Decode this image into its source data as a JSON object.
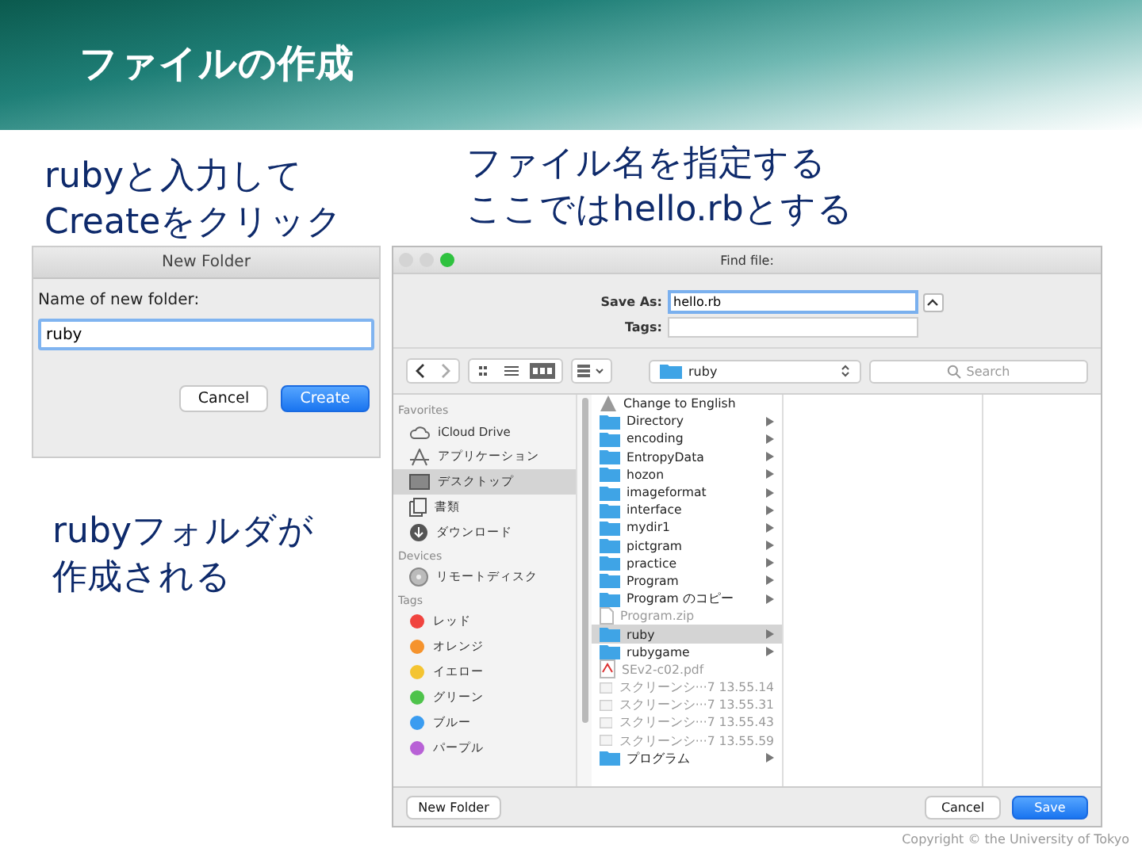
{
  "slide_title": "ファイルの作成",
  "captions": [
    {
      "lines": [
        "rubyと入力して",
        "Createをクリック"
      ]
    },
    {
      "lines": [
        "ファイル名を指定する",
        "ここではhello.rbとする"
      ]
    },
    {
      "lines": [
        "rubyフォルダが",
        "作成される"
      ]
    }
  ],
  "new_folder_dialog": {
    "title": "New Folder",
    "label": "Name of new folder:",
    "value": "ruby",
    "buttons": [
      {
        "label": "Cancel",
        "default": false
      },
      {
        "label": "Create",
        "default": true
      }
    ]
  },
  "save_dialog": {
    "title": "Find file:",
    "save_as_label": "Save As:",
    "save_as_value": "hello.rb",
    "tags_label": "Tags:",
    "location": "ruby",
    "search_placeholder": "Search",
    "sidebar": [
      {
        "heading": "Favorites",
        "items": [
          {
            "label": "iCloud Drive",
            "kind": "cloud",
            "selected": false
          },
          {
            "label": "アプリケーション",
            "kind": "apps",
            "selected": false
          },
          {
            "label": "デスクトップ",
            "kind": "desktop",
            "selected": true
          },
          {
            "label": "書類",
            "kind": "documents",
            "selected": false
          },
          {
            "label": "ダウンロード",
            "kind": "download",
            "selected": false
          }
        ]
      },
      {
        "heading": "Devices",
        "items": [
          {
            "label": "リモートディスク",
            "kind": "disc",
            "selected": false
          }
        ]
      },
      {
        "heading": "Tags",
        "items": [
          {
            "label": "レッド",
            "kind": "tag",
            "color": "#f0443f",
            "selected": false
          },
          {
            "label": "オレンジ",
            "kind": "tag",
            "color": "#f5932d",
            "selected": false
          },
          {
            "label": "イエロー",
            "kind": "tag",
            "color": "#f4c431",
            "selected": false
          },
          {
            "label": "グリーン",
            "kind": "tag",
            "color": "#4ec34b",
            "selected": false
          },
          {
            "label": "ブルー",
            "kind": "tag",
            "color": "#3a9cf0",
            "selected": false
          },
          {
            "label": "パープル",
            "kind": "tag",
            "color": "#b861d6",
            "selected": false
          }
        ]
      }
    ],
    "files": [
      {
        "name": "Change to English",
        "kind": "app",
        "disabled": false,
        "selected": false,
        "has_children": false
      },
      {
        "name": "Directory",
        "kind": "folder",
        "disabled": false,
        "selected": false,
        "has_children": true
      },
      {
        "name": "encoding",
        "kind": "folder",
        "disabled": false,
        "selected": false,
        "has_children": true
      },
      {
        "name": "EntropyData",
        "kind": "folder",
        "disabled": false,
        "selected": false,
        "has_children": true
      },
      {
        "name": "hozon",
        "kind": "folder",
        "disabled": false,
        "selected": false,
        "has_children": true
      },
      {
        "name": "imageformat",
        "kind": "folder",
        "disabled": false,
        "selected": false,
        "has_children": true
      },
      {
        "name": "interface",
        "kind": "folder",
        "disabled": false,
        "selected": false,
        "has_children": true
      },
      {
        "name": "mydir1",
        "kind": "folder",
        "disabled": false,
        "selected": false,
        "has_children": true
      },
      {
        "name": "pictgram",
        "kind": "folder",
        "disabled": false,
        "selected": false,
        "has_children": true
      },
      {
        "name": "practice",
        "kind": "folder",
        "disabled": false,
        "selected": false,
        "has_children": true
      },
      {
        "name": "Program",
        "kind": "folder",
        "disabled": false,
        "selected": false,
        "has_children": true
      },
      {
        "name": "Program のコピー",
        "kind": "folder",
        "disabled": false,
        "selected": false,
        "has_children": true
      },
      {
        "name": "Program.zip",
        "kind": "file",
        "disabled": true,
        "selected": false,
        "has_children": false
      },
      {
        "name": "ruby",
        "kind": "folder",
        "disabled": false,
        "selected": true,
        "has_children": true
      },
      {
        "name": "rubygame",
        "kind": "folder",
        "disabled": false,
        "selected": false,
        "has_children": true
      },
      {
        "name": "SEv2-c02.pdf",
        "kind": "pdf",
        "disabled": true,
        "selected": false,
        "has_children": false
      },
      {
        "name": "スクリーンシ···7 13.55.14",
        "kind": "image",
        "disabled": true,
        "selected": false,
        "has_children": false
      },
      {
        "name": "スクリーンシ···7 13.55.31",
        "kind": "image",
        "disabled": true,
        "selected": false,
        "has_children": false
      },
      {
        "name": "スクリーンシ···7 13.55.43",
        "kind": "image",
        "disabled": true,
        "selected": false,
        "has_children": false
      },
      {
        "name": "スクリーンシ···7 13.55.59",
        "kind": "image",
        "disabled": true,
        "selected": false,
        "has_children": false
      },
      {
        "name": "プログラム",
        "kind": "folder",
        "disabled": false,
        "selected": false,
        "has_children": true
      }
    ],
    "new_folder_button": "New Folder",
    "buttons": [
      {
        "label": "Cancel",
        "default": false
      },
      {
        "label": "Save",
        "default": true
      }
    ]
  },
  "copyright": "Copyright © the University of Tokyo"
}
